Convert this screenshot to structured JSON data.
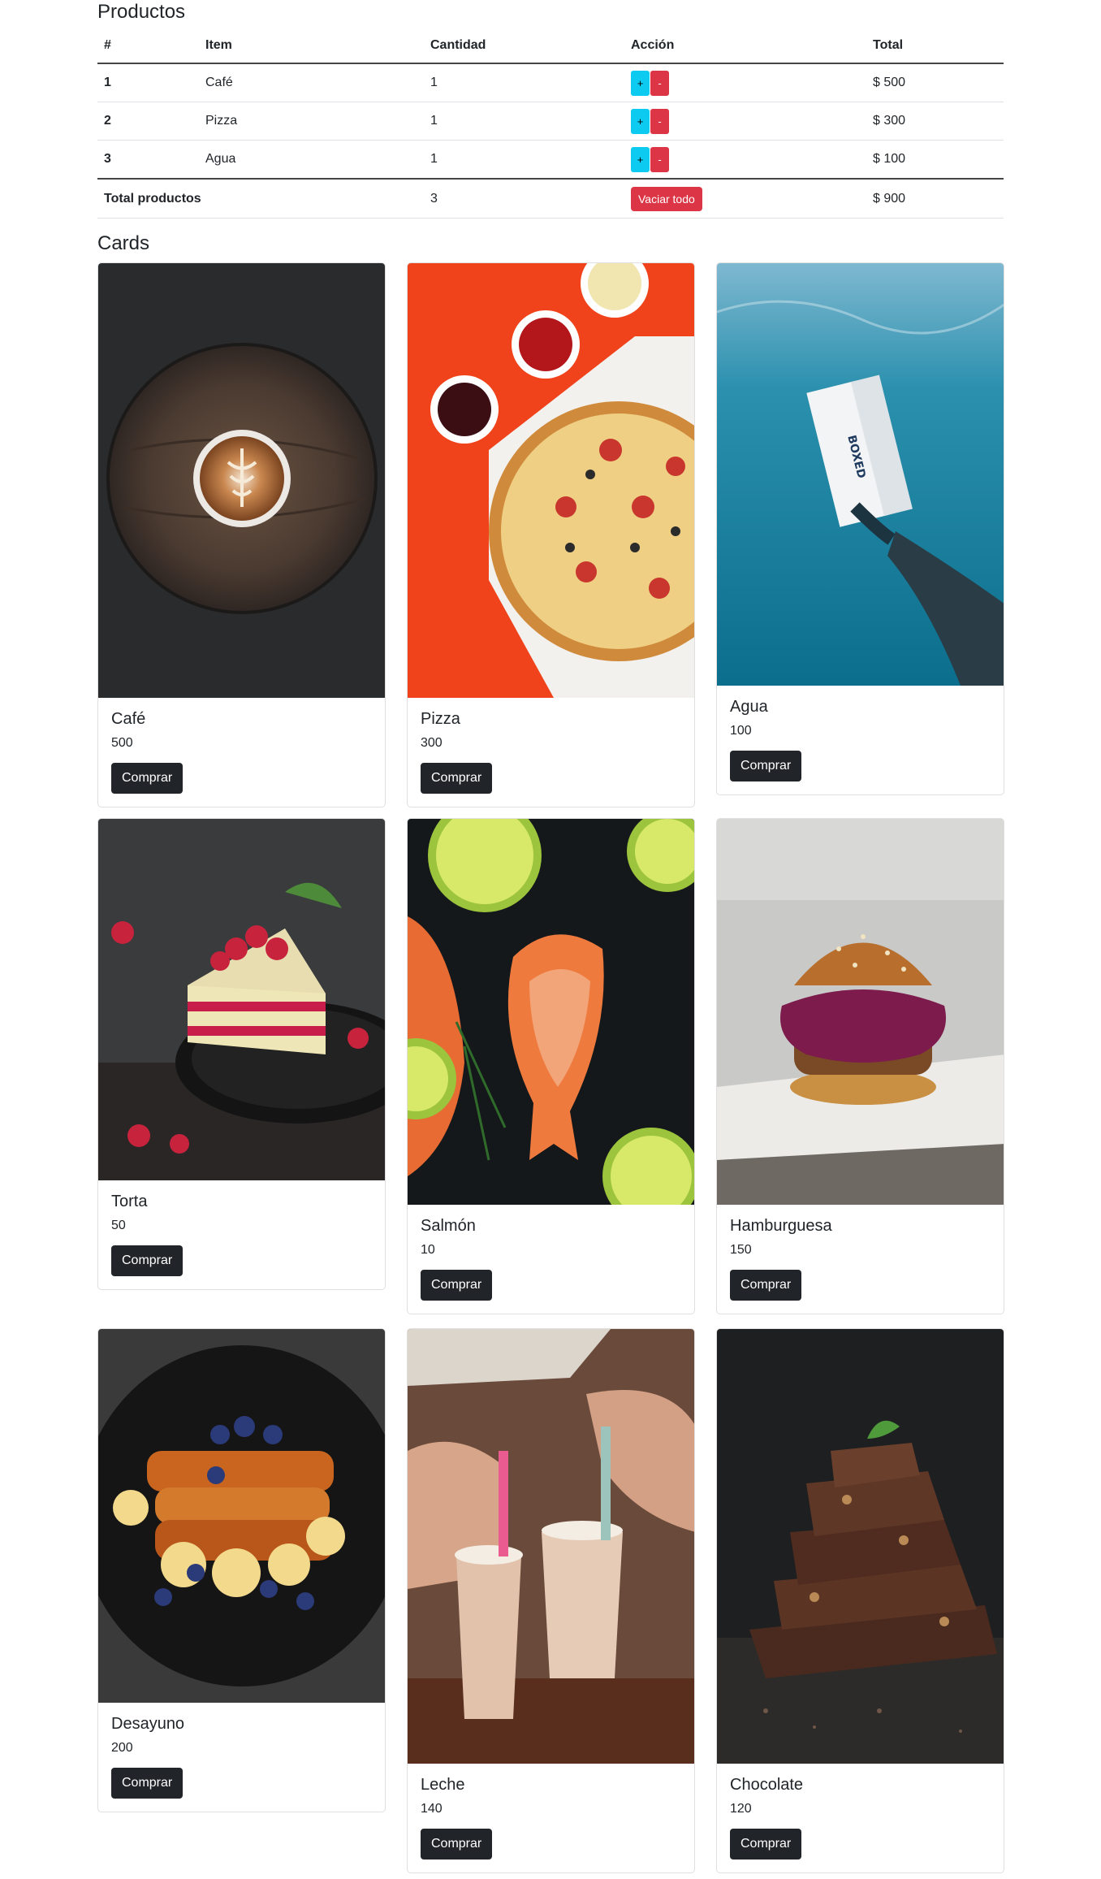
{
  "productos": {
    "title": "Productos",
    "headers": [
      "#",
      "Item",
      "Cantidad",
      "Acción",
      "Total"
    ],
    "rows": [
      {
        "num": "1",
        "item": "Café",
        "qty": "1",
        "plus": "+",
        "minus": "-",
        "total": "$ 500"
      },
      {
        "num": "2",
        "item": "Pizza",
        "qty": "1",
        "plus": "+",
        "minus": "-",
        "total": "$ 300"
      },
      {
        "num": "3",
        "item": "Agua",
        "qty": "1",
        "plus": "+",
        "minus": "-",
        "total": "$ 100"
      }
    ],
    "footer": {
      "label": "Total productos",
      "qty": "3",
      "clear_label": "Vaciar todo",
      "total": "$ 900"
    }
  },
  "cards_section": {
    "title": "Cards",
    "buy_label": "Comprar",
    "items": [
      {
        "name": "Café",
        "price": "500",
        "image": "latte-art-cup-on-wooden-board"
      },
      {
        "name": "Pizza",
        "price": "300",
        "image": "pizza-on-orange-background"
      },
      {
        "name": "Agua",
        "price": "100",
        "image": "water-carton-underwater"
      },
      {
        "name": "Torta",
        "price": "50",
        "image": "raspberry-cake-slice"
      },
      {
        "name": "Salmón",
        "price": "10",
        "image": "salmon-steaks-with-limes"
      },
      {
        "name": "Hamburguesa",
        "price": "150",
        "image": "burger-with-purple-cabbage"
      },
      {
        "name": "Desayuno",
        "price": "200",
        "image": "french-toast-with-berries"
      },
      {
        "name": "Leche",
        "price": "140",
        "image": "milkshakes-with-straws"
      },
      {
        "name": "Chocolate",
        "price": "120",
        "image": "stacked-chocolate-pieces"
      }
    ]
  },
  "colors": {
    "plus_button": "#0dcaf0",
    "minus_button": "#dc3545",
    "buy_button": "#212529"
  }
}
